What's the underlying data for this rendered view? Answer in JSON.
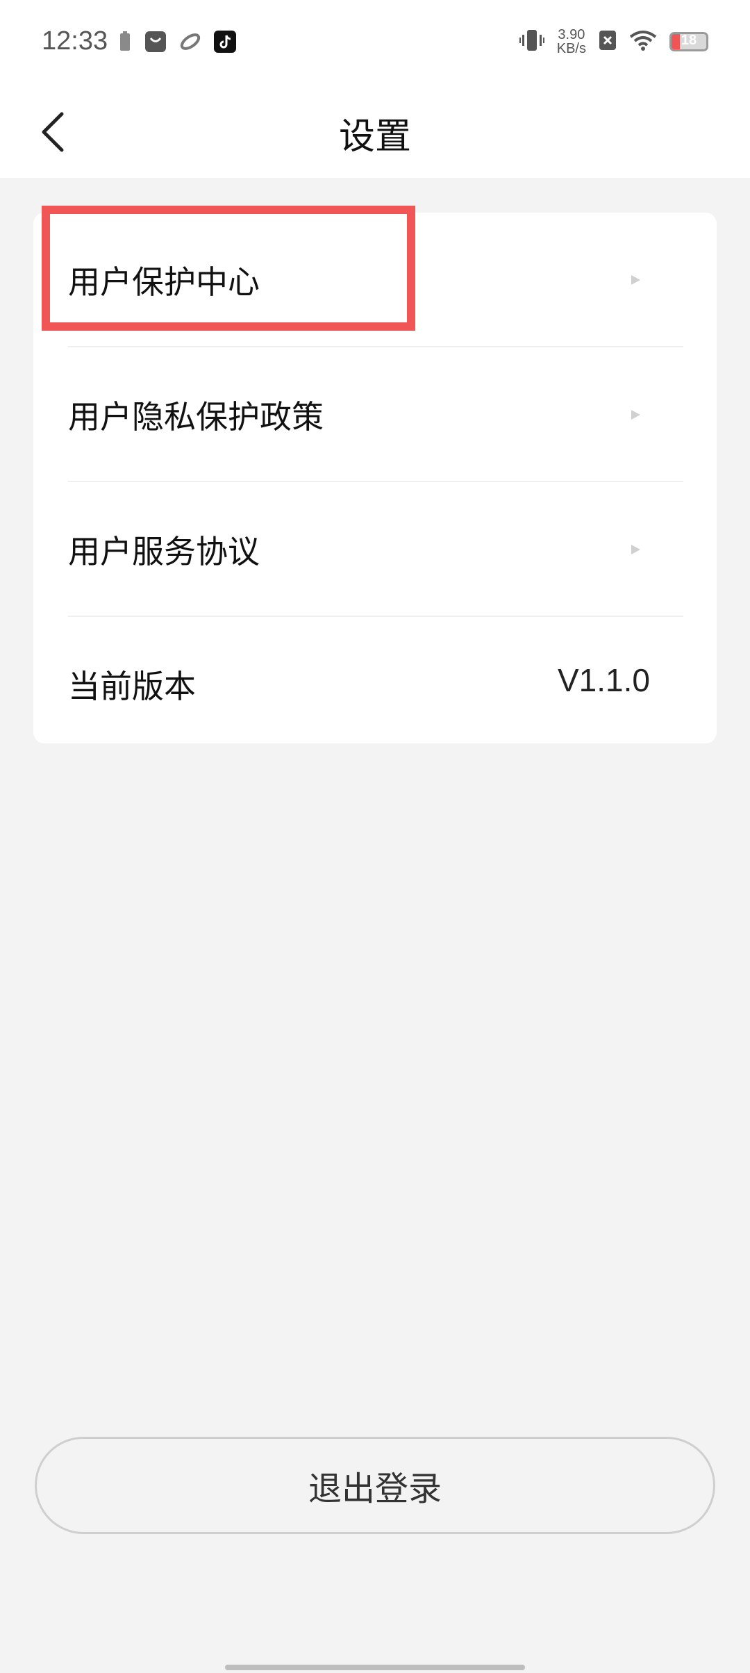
{
  "status_bar": {
    "time": "12:33",
    "net_speed_value": "3.90",
    "net_speed_unit": "KB/s",
    "battery_level": "18",
    "icons": [
      "battery-small-icon",
      "shopping-bag-icon",
      "planet-icon",
      "tiktok-icon",
      "vibrate-icon",
      "notification-close-icon",
      "wifi-icon",
      "battery-icon"
    ]
  },
  "header": {
    "title": "设置"
  },
  "settings": {
    "items": [
      {
        "label": "用户保护中心"
      },
      {
        "label": "用户隐私保护政策"
      },
      {
        "label": "用户服务协议"
      },
      {
        "label": "当前版本",
        "value": "V1.1.0"
      }
    ]
  },
  "logout": {
    "label": "退出登录"
  },
  "colors": {
    "background": "#f3f3f3",
    "card": "#ffffff",
    "highlight": "#f05656",
    "battery_low": "#f05454"
  }
}
